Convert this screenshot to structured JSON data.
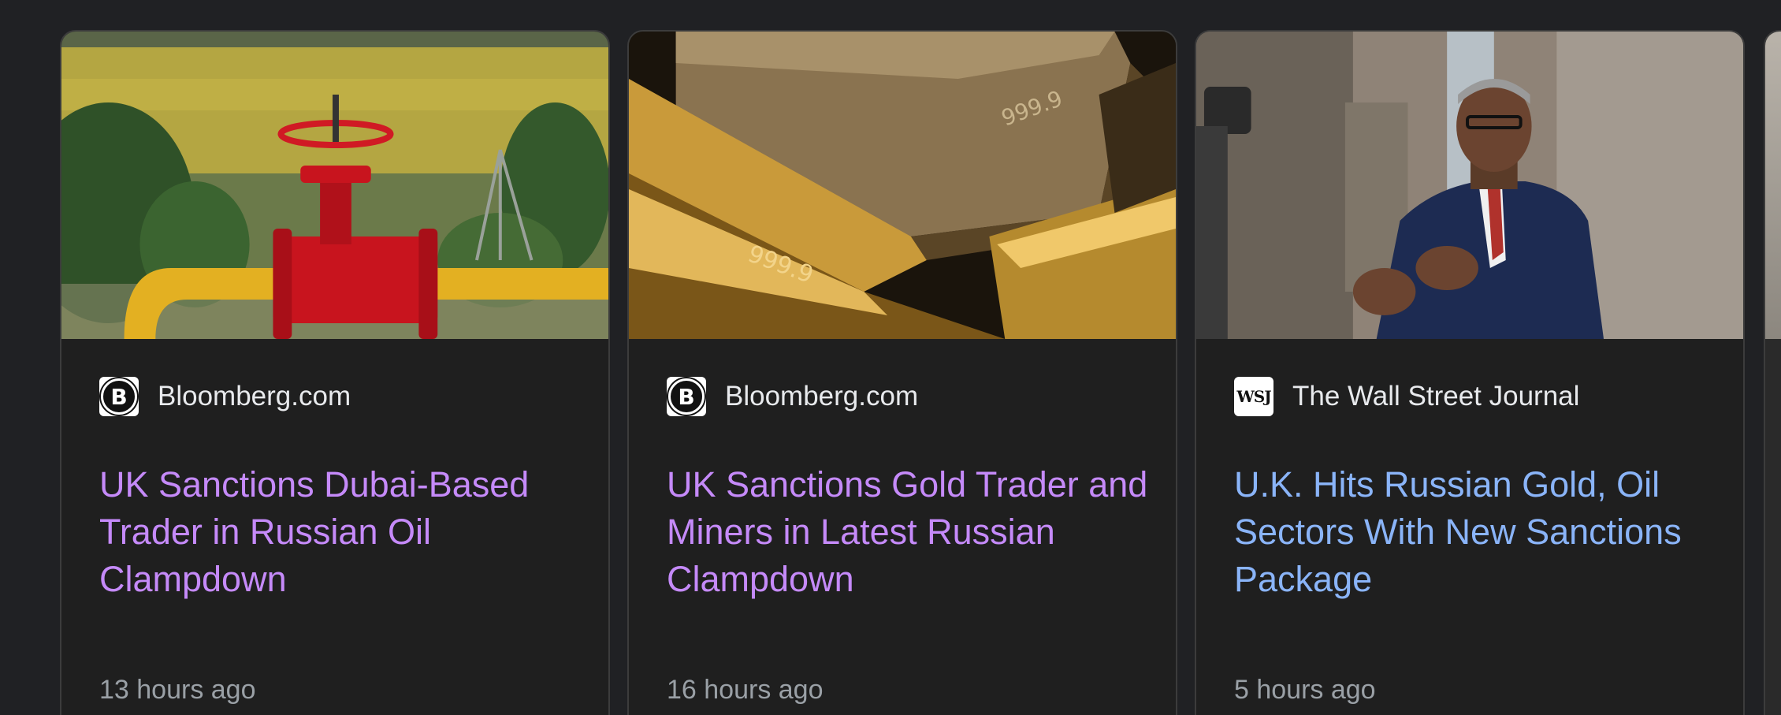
{
  "cards": [
    {
      "source": "Bloomberg.com",
      "favicon_icon": "bloomberg-favicon-icon",
      "headline": "UK Sanctions Dubai-Based Trader in Russian Oil Clampdown",
      "time": "13 hours ago",
      "image_icon": "oil-pipeline-valve-image",
      "visited": true
    },
    {
      "source": "Bloomberg.com",
      "favicon_icon": "bloomberg-favicon-icon",
      "headline": "UK Sanctions Gold Trader and Miners in Latest Russian Clampdown",
      "time": "16 hours ago",
      "image_icon": "gold-bars-image",
      "visited": true
    },
    {
      "source": "The Wall Street Journal",
      "favicon_icon": "wsj-favicon-icon",
      "headline": "U.K. Hits Russian Gold, Oil Sectors With New Sanctions Package",
      "time": "5 hours ago",
      "image_icon": "speaker-photo-image",
      "visited": false
    }
  ],
  "colors": {
    "background": "#202124",
    "card": "#1f1f1f",
    "visited_link": "#c58af9",
    "link": "#8ab4f8",
    "meta_text": "#9aa0a6"
  }
}
